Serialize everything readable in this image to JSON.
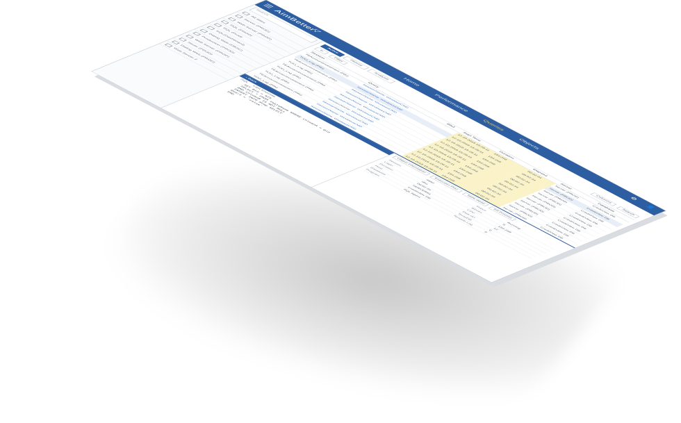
{
  "app": {
    "logo": "AimBetter",
    "logo_mark": "▽"
  },
  "nav": [
    "Home",
    "Performance",
    "Queries",
    "Objects"
  ],
  "nav_active_index": 2,
  "sidebar": {
    "search_placeholder": "Search",
    "items": [
      "All Sites",
      "Server (PROD)",
      "Web Server (PROD)",
      "SQL (PROD)",
      "SQL (Prod)",
      "SQL(Dashboard)",
      "Dialog Web (DBSC)",
      "Production (PROD)",
      "Web Server (PROD)",
      "Sever (PROD)",
      "Dialog Web (PROD)",
      "Web Server 2"
    ]
  },
  "tabs": [
    "Active",
    "History",
    "Analysis"
  ],
  "toolbar": {
    "filter": "Filter",
    "refresh": "↻",
    "columns": "Columns",
    "search_placeholder": "Search"
  },
  "grid": {
    "headers": [
      "Session",
      "Query",
      "",
      "Blkd",
      "Start Time",
      "Duration",
      "Elapsed",
      "Server",
      "Database"
    ],
    "rows": [
      [
        "TEAccountInvestment (PRI)",
        "SessionName: WindowsCMD",
        "",
        "",
        "12.10.2018 15:28:11",
        "154:268",
        "00:02:34",
        "Server (PROD)",
        "CreditView DB"
      ],
      [
        "TOO_Log (PRI)",
        "SessionName: WindowsCMD",
        "",
        "",
        "12.10.2018 15:28:11",
        "154:268",
        "00:02:34",
        "Server (PROD)",
        "CreditView DB"
      ],
      [
        "TEAccountInvestment (PRI)",
        "SessionName: WindowsCMD",
        "",
        "",
        "12.10.2018 15:28:11",
        "154:268",
        "00:02:34",
        "Server (PROD)",
        "CreditView DB"
      ],
      [
        "TOO_Log (PRI)",
        "SessionName: WindowsCMD",
        "",
        "",
        "12.10.2018 15:28:11",
        "154:268",
        "00:02:34",
        "Server (PROD)",
        "CreditView DB"
      ],
      [
        "TEAccountInvestment (PRI)",
        "SessionName: WindowsCMD",
        "",
        "",
        "12.10.2018 15:28:11",
        "154:268",
        "00:02:34",
        "Server (PROD)",
        "CreditView DB"
      ],
      [
        "TOO_Log (PRI)",
        "SessionName: WindowsCMD",
        "",
        "",
        "12.10.2018 15:28:11",
        "154:268",
        "00:02:34",
        "Server (PROD)",
        "CreditView DB"
      ],
      [
        "TEAccountInvestment (PRI)",
        "SessionName: WindowsCMD",
        "",
        "",
        "12.10.2018 15:28:11",
        "154:268",
        "00:02:34",
        "Server (PROD)",
        "CreditView DB"
      ],
      [
        "TOO_Log (PRI)",
        "SessionName: WindowsCMD",
        "",
        "",
        "12.10.2018 15:28:11",
        "154:268",
        "00:02:34",
        "Server (PROD)",
        "CreditView DB"
      ],
      [
        "TEAccountInvestment (PRI)",
        "SessionName: WindowsCMD",
        "",
        "",
        "12.10.2018 15:28:11",
        "154:268",
        "00:02:34",
        "Server (PROD)",
        "CreditView DB"
      ],
      [
        "TOO_Log (PRI)",
        "SessionName: WindowsCMD",
        "",
        "",
        "12.10.2018 15:28:11",
        "154:268",
        "00:02:34",
        "Server (PROD)",
        "CreditView DB"
      ]
    ]
  },
  "sql": {
    "back": "Back",
    "tabs": [
      "SQL",
      "Last Execute"
    ],
    "lines": [
      "SET @id = 425",
      "SELECT * FROM TableName WHERE ColumnA = @id",
      "AND ColumnB IS NOT NULL",
      "INSERT INTO #tmp SELECT",
      "@Var1 = 'value'",
      "END"
    ]
  },
  "detail": {
    "buttons": [
      "Object Information",
      "Execution Plan",
      "Table detail",
      "Kill Process"
    ],
    "pairs": [
      [
        "Session",
        "4592",
        "Status",
        "Running"
      ],
      [
        "Login",
        "dbo",
        "Blocks",
        "0"
      ],
      [
        "Duration",
        "00:02:34",
        "CPU",
        "154:268"
      ],
      [
        "Host",
        "SERVER01",
        "Disk I/O",
        "12"
      ],
      [
        "Database",
        "CreditView DB",
        "TempDB",
        "0"
      ],
      [
        "Program",
        "SQL Agent",
        "Tempdb Log",
        "0"
      ]
    ]
  }
}
